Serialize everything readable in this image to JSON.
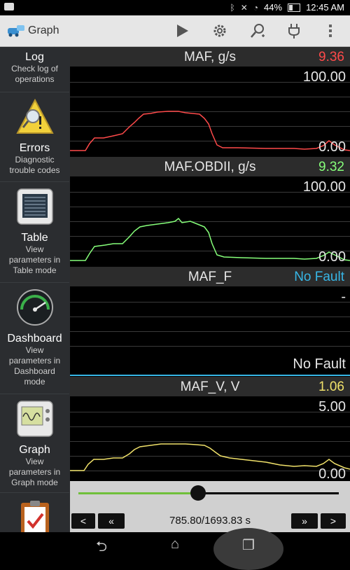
{
  "status": {
    "battery": "44%",
    "time": "12:45 AM"
  },
  "app": {
    "title": "Graph"
  },
  "sidebar": {
    "items": [
      {
        "title": "Log",
        "desc": "Check log of operations"
      },
      {
        "title": "Errors",
        "desc": "Diagnostic trouble codes"
      },
      {
        "title": "Table",
        "desc": "View parameters in Table mode"
      },
      {
        "title": "Dashboard",
        "desc": "View parameters in Dashboard mode"
      },
      {
        "title": "Graph",
        "desc": "View parameters in Graph mode"
      }
    ]
  },
  "panels": [
    {
      "name": "MAF, g/s",
      "value": "9.36",
      "color": "#ff4a4a",
      "max": "100.00",
      "min": "0.00"
    },
    {
      "name": "MAF.OBDII, g/s",
      "value": "9.32",
      "color": "#86ff7a",
      "max": "100.00",
      "min": "0.00"
    },
    {
      "name": "MAF_F",
      "value": "No Fault",
      "color": "#37b6e6",
      "max": "-",
      "min": "No Fault"
    },
    {
      "name": "MAF_V, V",
      "value": "1.06",
      "color": "#f0e16a",
      "max": "5.00",
      "min": "0.00"
    }
  ],
  "controls": {
    "position_fraction": 0.46,
    "time": "785.80/1693.83 s",
    "prev": "<",
    "rewind": "«",
    "forward": "»",
    "next": ">"
  },
  "colors": {
    "maf": "#ff4a4a",
    "obd": "#86ff7a",
    "fault": "#37b6e6",
    "volt": "#f0e16a",
    "slider": "#6fbf3a"
  }
}
